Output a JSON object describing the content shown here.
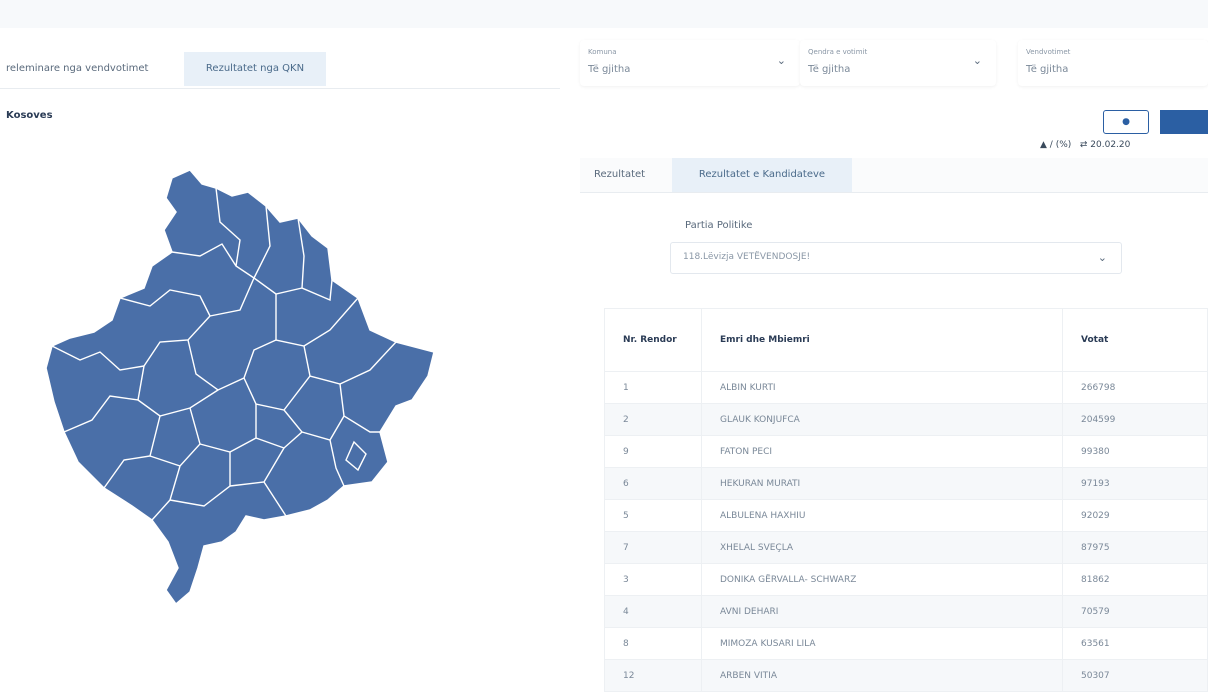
{
  "tabs": [
    "releminare nga vendvotimet",
    "Rezultatet nga QKN"
  ],
  "region_title": "Kosoves",
  "filters": [
    {
      "label": "Komuna",
      "value": "Të gjitha"
    },
    {
      "label": "Qendra e votimit",
      "value": "Të gjitha"
    },
    {
      "label": "Vendvotimet",
      "value": "Të gjitha"
    }
  ],
  "meta": {
    "pct": "/ (%)",
    "date": "20.02.20"
  },
  "panel": {
    "tabs": [
      "Rezultatet",
      "Rezultatet e Kandidateve"
    ],
    "party_label": "Partia Politike",
    "party_value": "118.Lëvizja VETËVENDOSJE!"
  },
  "table": {
    "headers": [
      "Nr. Rendor",
      "Emri dhe Mbiemri",
      "Votat"
    ],
    "rows": [
      [
        "1",
        "ALBIN KURTI",
        "266798"
      ],
      [
        "2",
        "GLAUK KONJUFCA",
        "204599"
      ],
      [
        "9",
        "FATON PECI",
        "99380"
      ],
      [
        "6",
        "HEKURAN MURATI",
        "97193"
      ],
      [
        "5",
        "ALBULENA HAXHIU",
        "92029"
      ],
      [
        "7",
        "XHELAL SVEÇLA",
        "87975"
      ],
      [
        "3",
        "DONIKA GËRVALLA- SCHWARZ",
        "81862"
      ],
      [
        "4",
        "AVNI DEHARI",
        "70579"
      ],
      [
        "8",
        "MIMOZA KUSARI LILA",
        "63561"
      ],
      [
        "12",
        "ARBEN VITIA",
        "50307"
      ]
    ]
  },
  "colors": {
    "map": "#4a6fa8",
    "accent": "#2b5fa3"
  }
}
